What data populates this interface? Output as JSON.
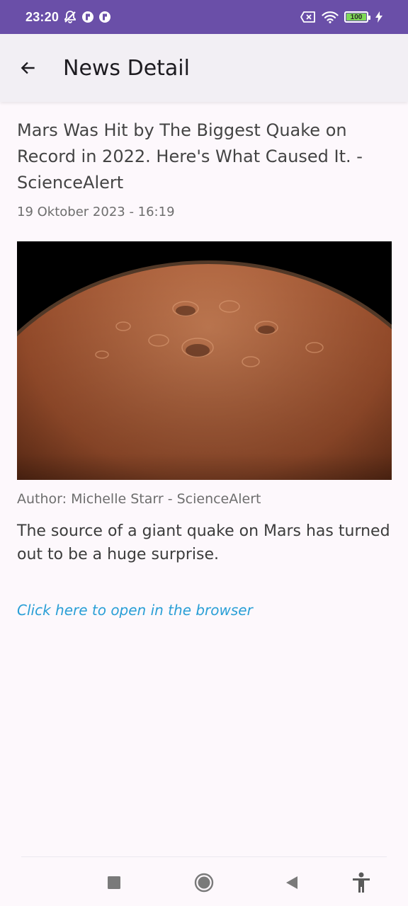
{
  "status_bar": {
    "time": "23:20",
    "battery_level": "100",
    "icons": [
      "notifications-off-icon",
      "app-notification-icon",
      "app-notification-icon",
      "sim-off-icon",
      "wifi-icon",
      "battery-icon",
      "charging-icon"
    ]
  },
  "app_bar": {
    "title": "News Detail",
    "back_icon": "arrow-back-icon"
  },
  "article": {
    "title": "Mars Was Hit by The Biggest Quake on Record in 2022. Here's What Caused It. - ScienceAlert",
    "date": "19 Oktober 2023 - 16:19",
    "image_alt": "mars-surface-image",
    "author": "Author: Michelle Starr - ScienceAlert",
    "summary": "The source of a giant quake on Mars has turned out to be a huge surprise.",
    "open_link": "Click here to open in the browser"
  },
  "nav_bar": {
    "buttons": [
      "recents-icon",
      "home-icon",
      "back-icon",
      "accessibility-icon"
    ]
  },
  "colors": {
    "status_bar": "#6a4fa8",
    "app_bar": "#f2eff4",
    "background": "#fdf8fc",
    "link": "#2a9fd6",
    "battery_fill": "#7ed957"
  }
}
